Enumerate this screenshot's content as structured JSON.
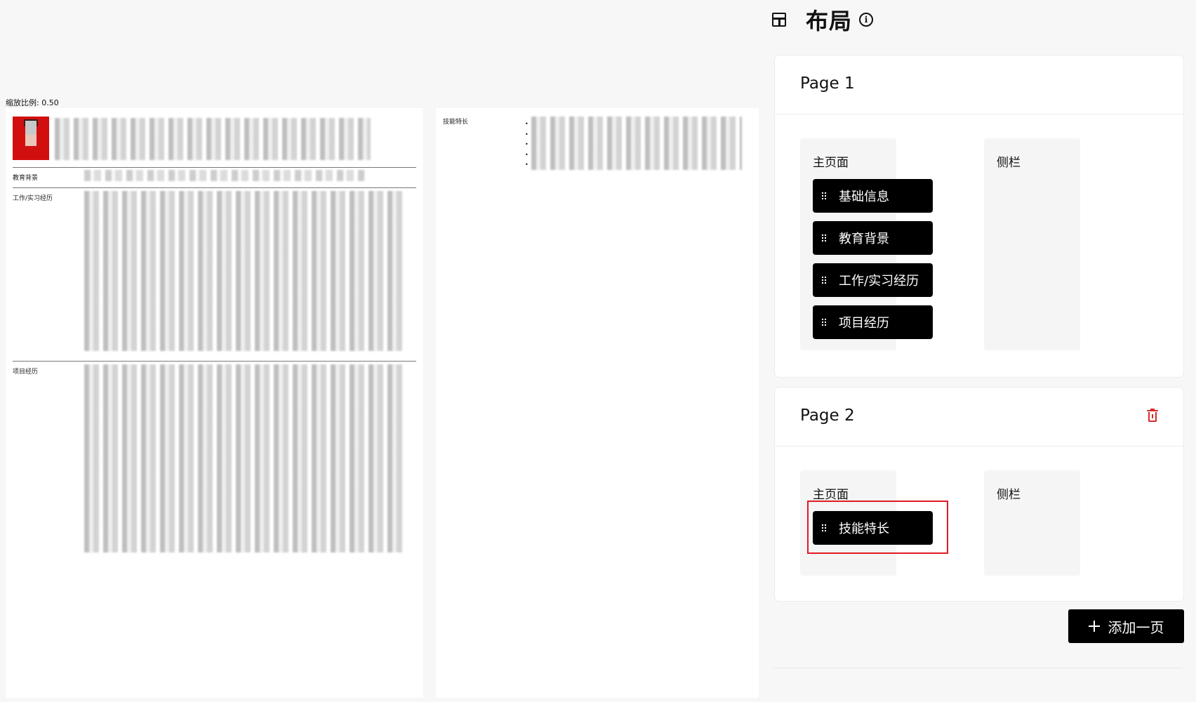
{
  "preview": {
    "scale_label": "缩放比例: 0.50",
    "page1_sections": [
      "教育背景",
      "工作/实习经历",
      "项目经历"
    ],
    "page2_sections": [
      "技能特长"
    ],
    "bullet_char": "•"
  },
  "panel": {
    "title": "布局",
    "title_icon": "layout-icon",
    "info_icon": "info-icon",
    "info_glyph": "i",
    "pages": [
      {
        "title": "Page 1",
        "deletable": false,
        "main_label": "主页面",
        "sidebar_label": "侧栏",
        "main_items": [
          "基础信息",
          "教育背景",
          "工作/实习经历",
          "项目经历"
        ],
        "sidebar_items": []
      },
      {
        "title": "Page 2",
        "deletable": true,
        "main_label": "主页面",
        "sidebar_label": "侧栏",
        "main_items": [
          "技能特长"
        ],
        "sidebar_items": []
      }
    ],
    "add_page_label": "添加一页"
  },
  "colors": {
    "accent_dark": "#000000",
    "delete_red": "#d62a2a",
    "highlight_red": "#e01b24",
    "photo_red": "#d20f0f"
  }
}
